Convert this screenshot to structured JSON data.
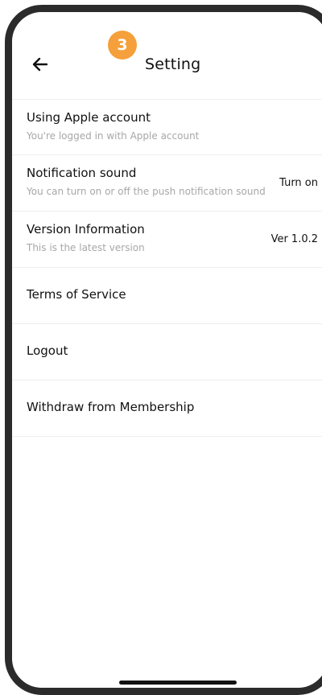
{
  "header": {
    "title": "Setting",
    "step_badge": "3",
    "back_icon": "arrow-left-icon"
  },
  "settings": [
    {
      "label": "Using Apple account",
      "sub": "You're logged in with Apple account",
      "value": ""
    },
    {
      "label": "Notification sound",
      "sub": "You can turn on or off the push notification sound",
      "value": "Turn on"
    },
    {
      "label": "Version Information",
      "sub": "This is the latest version",
      "value": "Ver 1.0.2"
    },
    {
      "label": "Terms of Service"
    },
    {
      "label": "Logout"
    },
    {
      "label": "Withdraw from Membership"
    }
  ],
  "colors": {
    "badge": "#f5a03a",
    "subtext": "#a7a7a7",
    "divider": "#eeeeee",
    "frame": "#2b2b2b"
  }
}
